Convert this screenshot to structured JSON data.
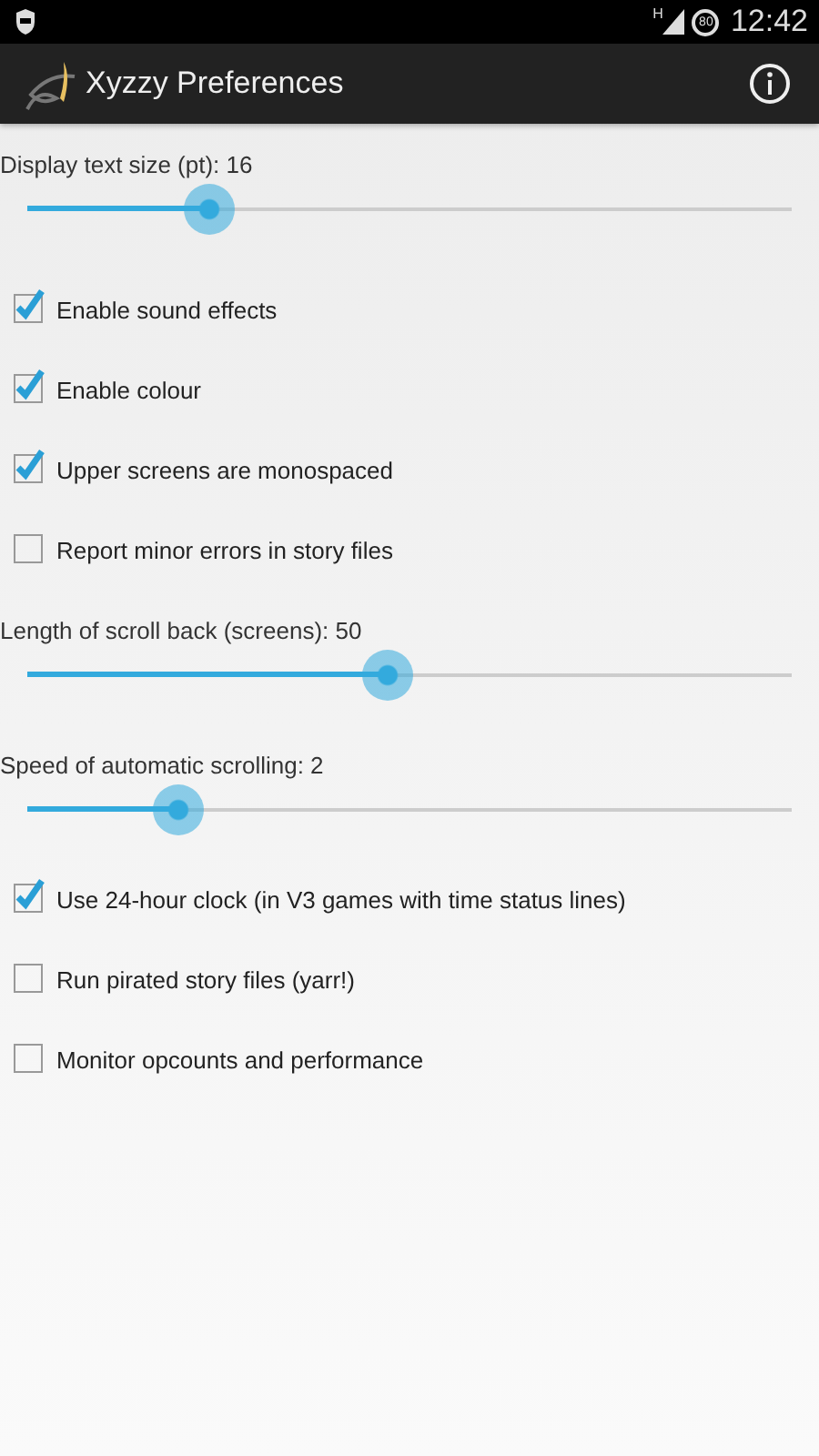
{
  "status_bar": {
    "network": "H",
    "battery": "80",
    "time": "12:42"
  },
  "action_bar": {
    "title": "Xyzzy Preferences"
  },
  "preferences": [
    {
      "kind": "slider",
      "label": "Display text size (pt): 16",
      "level": 0.238
    },
    {
      "kind": "checkbox",
      "label": "Enable sound effects",
      "checked": true
    },
    {
      "kind": "checkbox",
      "label": "Enable colour",
      "checked": true
    },
    {
      "kind": "checkbox",
      "label": "Upper screens are monospaced",
      "checked": true
    },
    {
      "kind": "checkbox",
      "label": "Report minor errors in story files",
      "checked": false
    },
    {
      "kind": "slider",
      "label": "Length of scroll back (screens): 50",
      "level": 0.471
    },
    {
      "kind": "slider",
      "label": "Speed of automatic scrolling: 2",
      "level": 0.198
    },
    {
      "kind": "checkbox",
      "label": "Use 24-hour clock (in V3 games with time status lines)",
      "checked": true
    },
    {
      "kind": "checkbox",
      "label": "Run pirated story files (yarr!)",
      "checked": false
    },
    {
      "kind": "checkbox",
      "label": "Monitor opcounts and performance",
      "checked": false
    }
  ]
}
